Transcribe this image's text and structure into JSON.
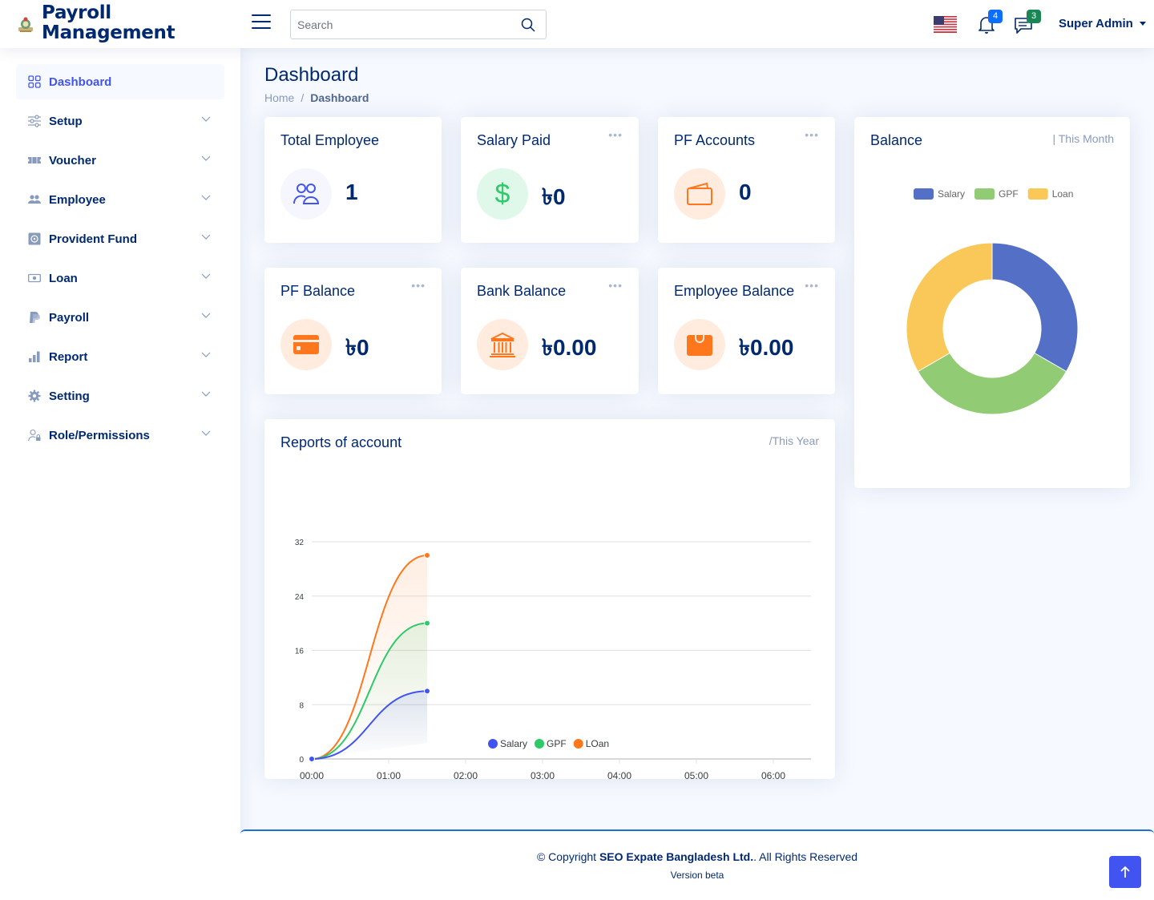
{
  "header": {
    "app_title_line1": "Payroll",
    "app_title_line2": "Management",
    "search_placeholder": "Search",
    "search_value": "",
    "language_icon": "us-flag-icon",
    "notifications_count": "4",
    "messages_count": "3",
    "user_name": "Super Admin"
  },
  "sidebar": {
    "items": [
      {
        "label": "Dashboard",
        "icon": "grid-icon",
        "active": true
      },
      {
        "label": "Setup",
        "icon": "sliders-icon"
      },
      {
        "label": "Voucher",
        "icon": "ticket-icon"
      },
      {
        "label": "Employee",
        "icon": "people-icon"
      },
      {
        "label": "Provident Fund",
        "icon": "safe-icon"
      },
      {
        "label": "Loan",
        "icon": "cash-icon"
      },
      {
        "label": "Payroll",
        "icon": "paypal-icon"
      },
      {
        "label": "Report",
        "icon": "bar-chart-icon"
      },
      {
        "label": "Setting",
        "icon": "gear-icon"
      },
      {
        "label": "Role/Permissions",
        "icon": "person-lock-icon"
      }
    ]
  },
  "page": {
    "title": "Dashboard",
    "breadcrumb": [
      "Home",
      "Dashboard"
    ],
    "breadcrumb_sep": "/"
  },
  "cards": [
    {
      "title": "Total Employee",
      "value": "1",
      "icon": "people-icon",
      "has_menu": false
    },
    {
      "title": "Salary Paid",
      "value": "৳0",
      "icon": "dollar-icon",
      "has_menu": true
    },
    {
      "title": "PF Accounts",
      "value": "0",
      "icon": "wallet-icon",
      "has_menu": true
    },
    {
      "title": "PF Balance",
      "value": "৳0",
      "icon": "credit-card-icon",
      "has_menu": true
    },
    {
      "title": "Bank Balance",
      "value": "৳0.00",
      "icon": "bank-icon",
      "has_menu": true
    },
    {
      "title": "Employee Balance",
      "value": "৳0.00",
      "icon": "wallet-fill-icon",
      "has_menu": true
    }
  ],
  "menu_dots": "•••",
  "colors": {
    "primary": "#4154f1",
    "navy": "#012970",
    "salary": "#5470c6",
    "gpf": "#91cc75",
    "loan": "#fac858",
    "line_salary": "#4154f1",
    "line_gpf": "#2eca6a",
    "line_loan": "#ff771d"
  },
  "balance_card": {
    "title": "Balance",
    "subtitle": "| This Month"
  },
  "reports_card": {
    "title": "Reports of account",
    "subtitle": "/This Year"
  },
  "chart_data": [
    {
      "type": "pie",
      "title": "Balance",
      "subtitle": "| This Month",
      "donut": true,
      "legend_position": "top",
      "categories": [
        "Salary",
        "GPF",
        "Loan"
      ],
      "values": [
        1,
        1,
        1
      ],
      "colors": [
        "#5470c6",
        "#91cc75",
        "#fac858"
      ]
    },
    {
      "type": "area",
      "title": "Reports of account",
      "subtitle": "/This Year",
      "xlabel": "",
      "ylabel": "",
      "x_ticks": [
        "00:00",
        "01:00",
        "02:00",
        "03:00",
        "04:00",
        "05:00",
        "06:00"
      ],
      "x_range_hours": [
        0,
        6.5
      ],
      "ylim": [
        0,
        32
      ],
      "y_ticks": [
        0,
        8,
        16,
        24,
        32
      ],
      "grid": true,
      "legend_position": "bottom",
      "x": [
        0,
        1.5
      ],
      "series": [
        {
          "name": "Salary",
          "values": [
            0,
            10
          ],
          "color": "#4154f1"
        },
        {
          "name": "GPF",
          "values": [
            0,
            20
          ],
          "color": "#2eca6a"
        },
        {
          "name": "LOan",
          "values": [
            0,
            30
          ],
          "color": "#ff771d"
        }
      ]
    }
  ],
  "footer": {
    "copyright_prefix": "© Copyright",
    "company": "SEO Expate Bangladesh Ltd.",
    "copyright_suffix": ". All Rights Reserved",
    "version": "Version beta"
  }
}
